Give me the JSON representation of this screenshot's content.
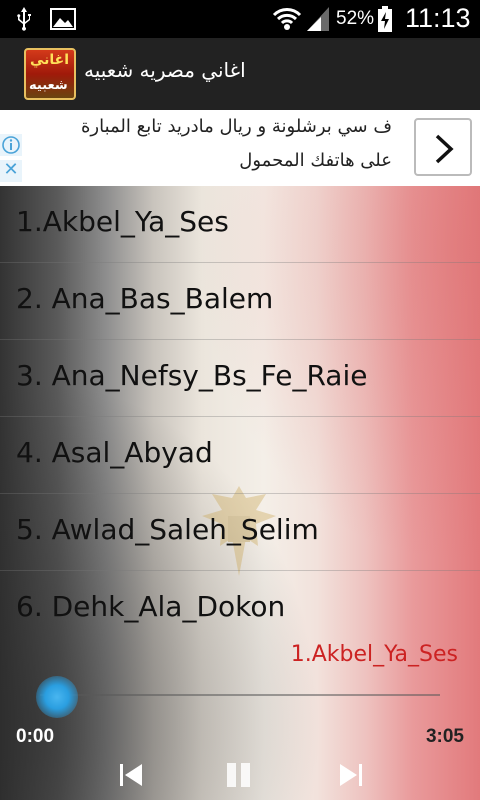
{
  "status_bar": {
    "battery_percent": "52%",
    "time": "11:13"
  },
  "app": {
    "title": "اغاني مصريه شعبيه",
    "icon_text_top": "اغاني",
    "icon_text_bottom": "شعبيه"
  },
  "ad": {
    "line1": "ف سي برشلونة و ريال مادريد تابع المبارة",
    "line2": "على هاتفك المحمول",
    "close_label": "✕"
  },
  "songs": [
    "1.Akbel_Ya_Ses",
    "2. Ana_Bas_Balem",
    "3. Ana_Nefsy_Bs_Fe_Raie",
    "4. Asal_Abyad",
    "5. Awlad_Saleh_Selim",
    "6. Dehk_Ala_Dokon"
  ],
  "player": {
    "now_playing": "1.Akbel_Ya_Ses",
    "current_time": "0:00",
    "total_time": "3:05",
    "progress_fraction": 0.0
  },
  "colors": {
    "action_bar": "#222222",
    "now_playing_text": "#cc2222",
    "seek_thumb": "#2a9ee0"
  }
}
